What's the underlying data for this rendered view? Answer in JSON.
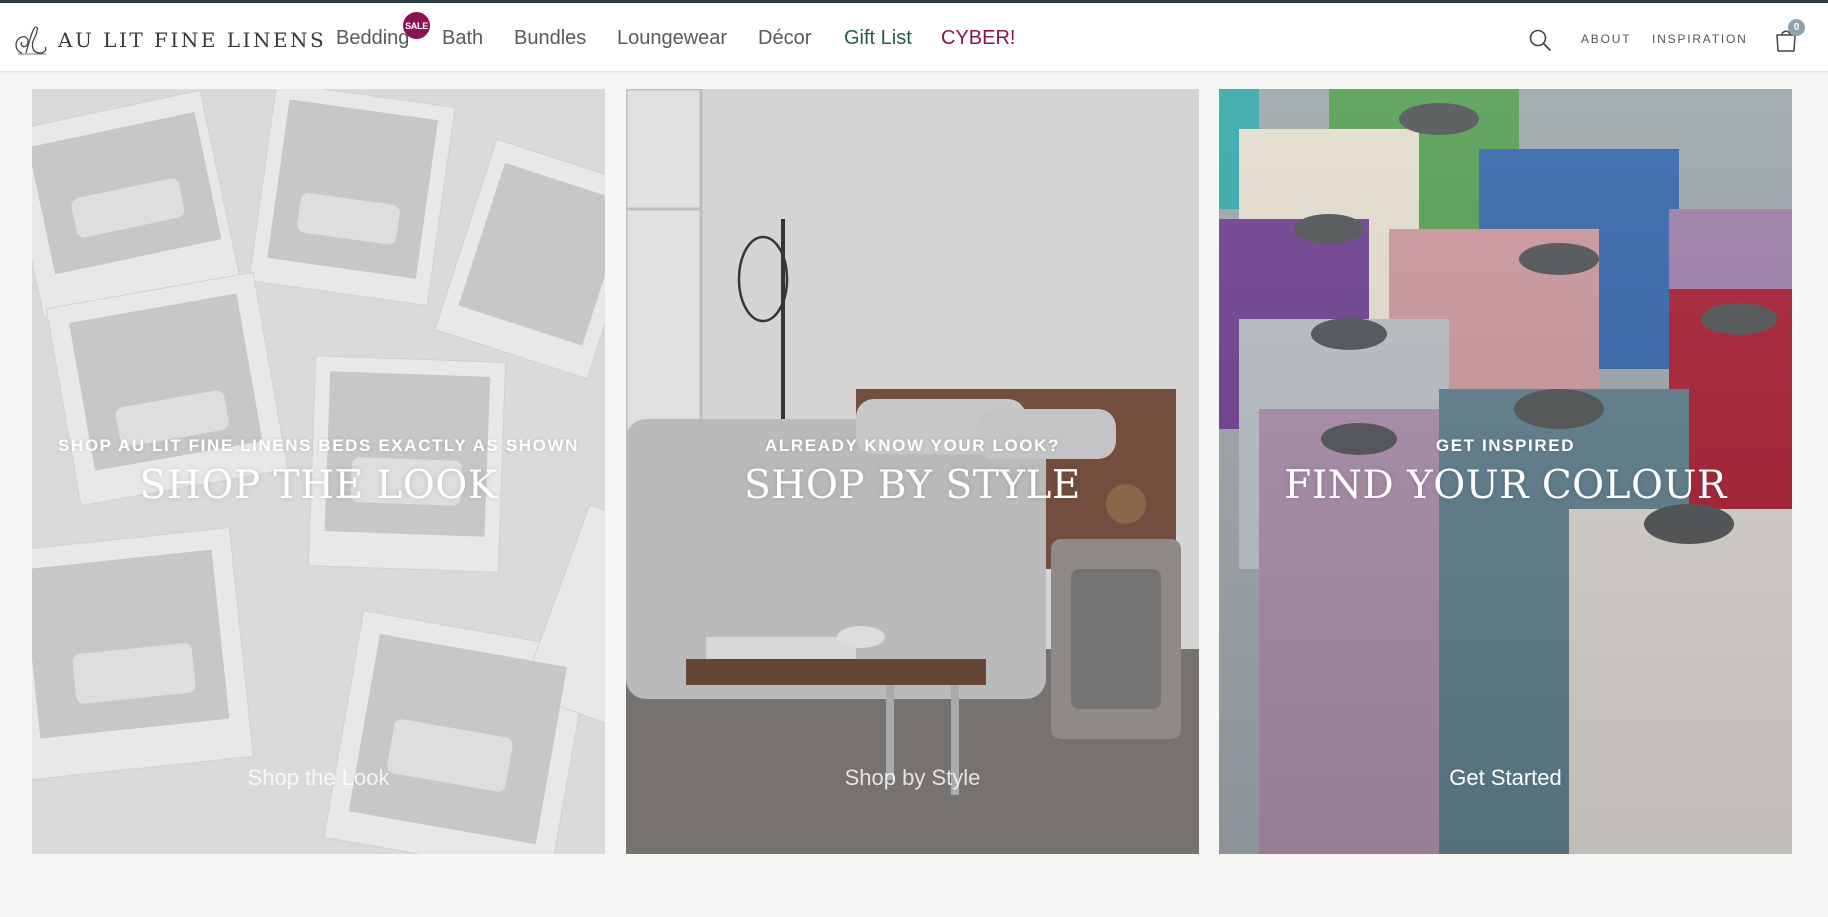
{
  "brand": {
    "name": "AU LIT FINE LINENS"
  },
  "nav": {
    "items": [
      {
        "label": "Bedding"
      },
      {
        "label": "Bath"
      },
      {
        "label": "Bundles"
      },
      {
        "label": "Loungewear"
      },
      {
        "label": "Décor"
      },
      {
        "label": "Gift List"
      },
      {
        "label": "CYBER!"
      }
    ],
    "sale_badge": "SALE"
  },
  "utility": {
    "about": "ABOUT",
    "inspiration": "INSPIRATION",
    "cart_count": "0"
  },
  "tiles": [
    {
      "eyebrow": "SHOP AU LIT FINE LINENS BEDS EXACTLY AS SHOWN",
      "title": "SHOP THE LOOK",
      "cta": "Shop the Look"
    },
    {
      "eyebrow": "ALREADY KNOW YOUR LOOK?",
      "title": "SHOP BY STYLE",
      "cta": "Shop by Style"
    },
    {
      "eyebrow": "GET INSPIRED",
      "title": "FIND YOUR COLOUR",
      "cta": "Get Started"
    }
  ],
  "colors": {
    "accent_sale": "#8a1452",
    "gift_green": "#1f5d48",
    "topline": "#2d3a40",
    "cart_badge": "#8ea3b2"
  }
}
